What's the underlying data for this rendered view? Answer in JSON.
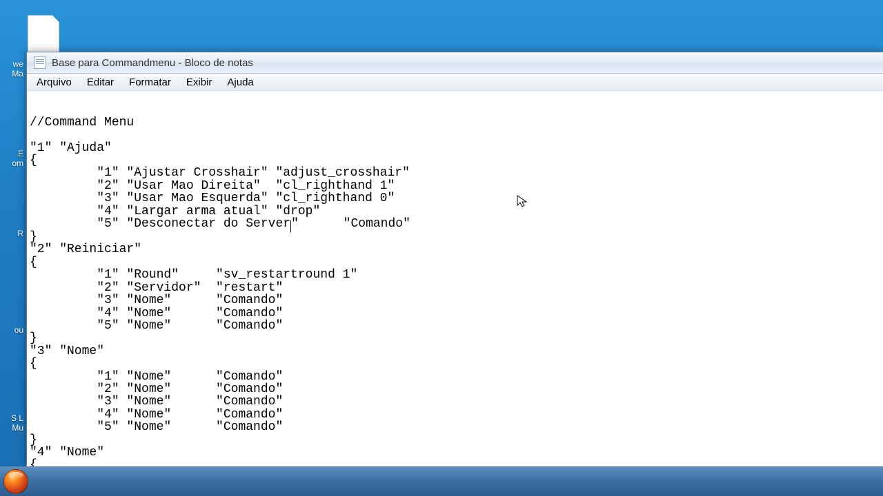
{
  "window": {
    "title": "Base para Commandmenu - Bloco de notas"
  },
  "menu": {
    "arquivo": "Arquivo",
    "editar": "Editar",
    "formatar": "Formatar",
    "exibir": "Exibir",
    "ajuda": "Ajuda"
  },
  "desktop": {
    "l1": "we",
    "l2": "Ma",
    "l3": "E",
    "l4": "om",
    "l5": "R",
    "l6": "ou",
    "l7": "S L",
    "l8": "Mu"
  },
  "editor": {
    "lines": [
      "//Command Menu",
      "",
      "\"1\" \"Ajuda\"",
      "{",
      "         \"1\" \"Ajustar Crosshair\" \"adjust_crosshair\"",
      "         \"2\" \"Usar Mao Direita\"  \"cl_righthand 1\"",
      "         \"3\" \"Usar Mao Esquerda\" \"cl_righthand 0\"",
      "         \"4\" \"Largar arma atual\" \"drop\"",
      "         \"5\" \"Desconectar do Server",
      "\"      \"Comando\"",
      "}",
      "\"2\" \"Reiniciar\"",
      "{",
      "         \"1\" \"Round\"     \"sv_restartround 1\"",
      "         \"2\" \"Servidor\"  \"restart\"",
      "         \"3\" \"Nome\"      \"Comando\"",
      "         \"4\" \"Nome\"      \"Comando\"",
      "         \"5\" \"Nome\"      \"Comando\"",
      "}",
      "\"3\" \"Nome\"",
      "{",
      "         \"1\" \"Nome\"      \"Comando\"",
      "         \"2\" \"Nome\"      \"Comando\"",
      "         \"3\" \"Nome\"      \"Comando\"",
      "         \"4\" \"Nome\"      \"Comando\"",
      "         \"5\" \"Nome\"      \"Comando\"",
      "}",
      "\"4\" \"Nome\"",
      "{"
    ]
  }
}
